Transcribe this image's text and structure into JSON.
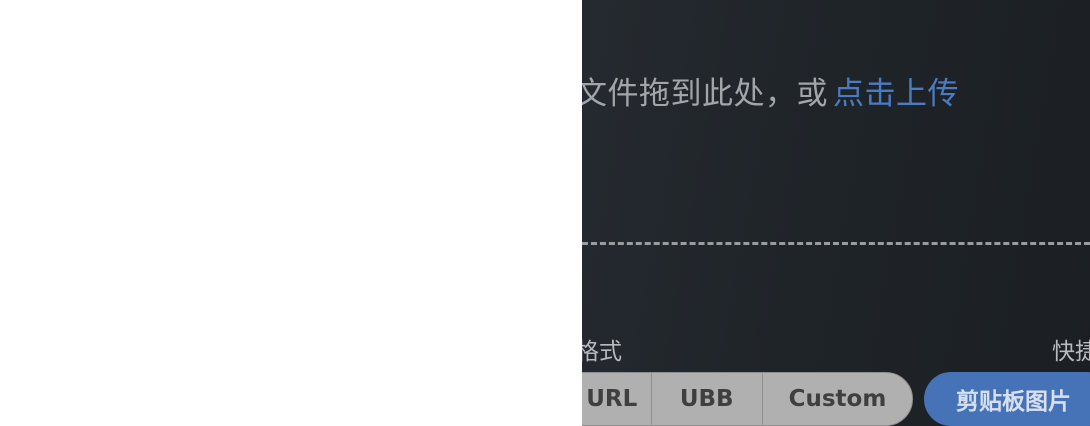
{
  "upload": {
    "drop_text": "文件拖到此处，或",
    "upload_link": "点击上传"
  },
  "options": {
    "format_label": "格式",
    "shortcut_label": "快捷",
    "format_buttons": [
      "URL",
      "UBB",
      "Custom"
    ],
    "paste_button": "剪贴板图片"
  },
  "colors": {
    "panel_bg": "#1f2429",
    "link": "#4a7cc4",
    "primary_button": "#4672b8"
  }
}
